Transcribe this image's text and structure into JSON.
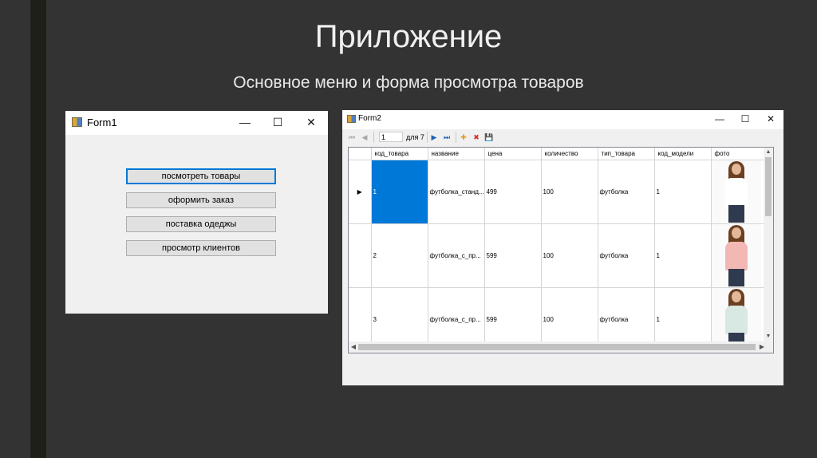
{
  "slide": {
    "title": "Приложение",
    "subtitle": "Основное меню и форма просмотра товаров"
  },
  "form1": {
    "title": "Form1",
    "controls": {
      "minimize": "—",
      "maximize": "☐",
      "close": "✕"
    },
    "buttons": [
      {
        "label": "посмотреть товары"
      },
      {
        "label": "оформить заказ"
      },
      {
        "label": "поставка одеджы"
      },
      {
        "label": "просмотр клиентов"
      }
    ]
  },
  "form2": {
    "title": "Form2",
    "controls": {
      "minimize": "—",
      "maximize": "☐",
      "close": "✕"
    },
    "navigator": {
      "position": "1",
      "count": "для 7",
      "icons": {
        "first": "⏮",
        "prev": "◀",
        "next": "▶",
        "last": "⏭",
        "add": "✚",
        "delete": "✖",
        "save": "💾"
      }
    },
    "grid": {
      "columns": [
        "код_товара",
        "название",
        "цена",
        "количество",
        "тип_товара",
        "код_модели",
        "фото"
      ],
      "current_row_marker": "▶",
      "rows": [
        {
          "cells": [
            "1",
            "футболка_станд...",
            "499",
            "100",
            "футболка",
            "1"
          ],
          "photo_color": "#ffffff"
        },
        {
          "cells": [
            "2",
            "футболка_с_пр...",
            "599",
            "100",
            "футболка",
            "1"
          ],
          "photo_color": "#f4b8b4"
        },
        {
          "cells": [
            "3",
            "футболка_с_пр...",
            "599",
            "100",
            "футболка",
            "1"
          ],
          "photo_color": "#d8e8e2"
        }
      ]
    },
    "scroll_icons": {
      "up": "▲",
      "down": "▼",
      "left": "◀",
      "right": "▶"
    }
  }
}
